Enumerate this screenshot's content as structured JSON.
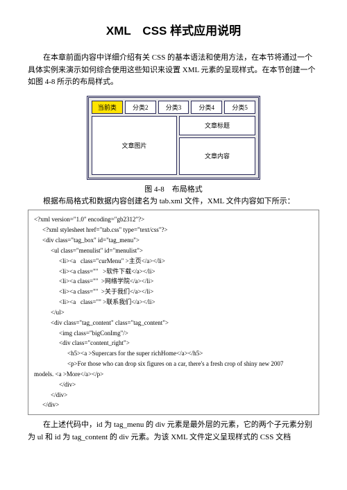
{
  "title": "XML　CSS 样式应用说明",
  "intro": "在本章前面内容中详细介绍有关 CSS 的基本语法和使用方法，在本节将通过一个具体实例来演示如何综合使用这些知识来设置 XML 元素的呈现样式。在本节创建一个如图 4-8 所示的布局样式。",
  "diagram": {
    "tabs": [
      "当前类",
      "分类2",
      "分类3",
      "分类4",
      "分类5"
    ],
    "left": "文章图片",
    "rightTitle": "文章标题",
    "rightContent": "文章内容"
  },
  "caption": "图 4-8　布局格式",
  "caption2": "根据布局格式和数据内容创建名为 tab.xml 文件，XML 文件内容如下所示：",
  "code": [
    {
      "i": 0,
      "t": "<?xml version=\"1.0\" encoding=\"gb2312\"?>"
    },
    {
      "i": 1,
      "t": "<?xml stylesheet href=\"tab.css\" type=\"text/css\"?>"
    },
    {
      "i": 1,
      "t": "<div class=\"tag_box\" id=\"tag_menu\">"
    },
    {
      "i": 2,
      "t": "<ul class=\"menulist\" id=\"menulist\">"
    },
    {
      "i": 3,
      "t": "<li><a   class=\"curMenu\" >主页</a></li>"
    },
    {
      "i": 3,
      "t": "<li><a class=\"\"   >软件下载</a></li>"
    },
    {
      "i": 3,
      "t": "<li><a class=\"\"  >网络学院</a></li>"
    },
    {
      "i": 3,
      "t": "<li><a class=\"\"  >关于我们</a></li>"
    },
    {
      "i": 3,
      "t": "<li><a   class=\"\" >联系我们</a></li>"
    },
    {
      "i": 2,
      "t": "</ul>"
    },
    {
      "i": 2,
      "t": "<div class=\"tag_content\" class=\"tag_content\">"
    },
    {
      "i": 3,
      "t": "<img class=\"bigConImg\"/>"
    },
    {
      "i": 3,
      "t": "<div class=\"content_right\">"
    },
    {
      "i": 4,
      "t": "<h5><a >Supercars for the super richHome</a></h5>"
    },
    {
      "i": 4,
      "t": "<p>For those who can drop six figures on a car, there's a fresh crop of shiny new 2007"
    },
    {
      "i": 0,
      "t": "models. <a >More</a></p>"
    },
    {
      "i": 3,
      "t": "</div>"
    },
    {
      "i": 2,
      "t": "</div>"
    },
    {
      "i": 1,
      "t": "</div>"
    }
  ],
  "footer": "在上述代码中，id 为 tag_menu 的 div 元素是最外层的元素，它的两个子元素分别为 ul 和 id 为 tag_content 的 div 元素。为该 XML 文件定义呈现样式的 CSS 文档"
}
